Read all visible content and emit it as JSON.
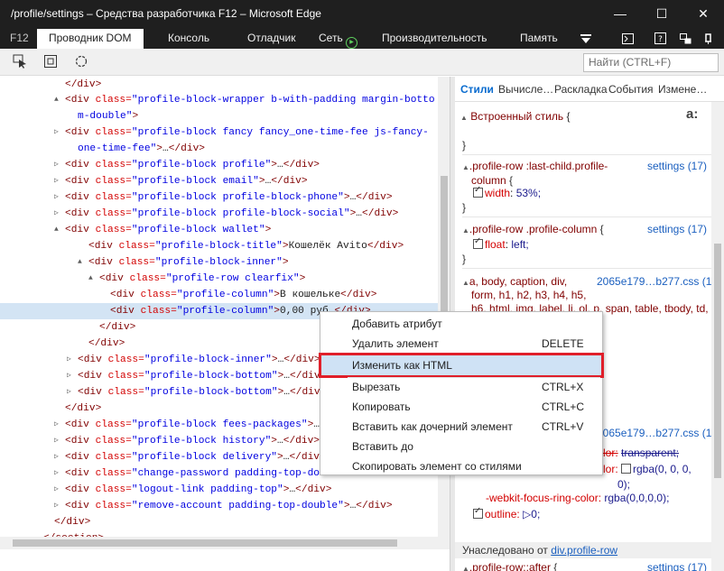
{
  "window": {
    "title": "/profile/settings – Средства разработчика F12 – Microsoft Edge",
    "minimize_icon": "—",
    "maximize_icon": "☐",
    "close_icon": "✕"
  },
  "tabs": {
    "f12": "F12",
    "items": [
      "Проводник DOM",
      "Консоль",
      "Отладчик",
      "Сеть",
      "Производительность",
      "Память"
    ],
    "network_icon": "▶"
  },
  "toolbar": {
    "find_placeholder": "Найти (CTRL+F)"
  },
  "dom_lines": [
    {
      "tri": "",
      "parts": [
        [
          "tag",
          "</div>"
        ]
      ]
    },
    {
      "tri": "▲",
      "parts": [
        [
          "tag",
          "<div "
        ],
        [
          "an",
          "class="
        ],
        [
          "av",
          "\"profile-block-wrapper b-with-padding margin-botto"
        ]
      ]
    },
    {
      "tri": "",
      "parts": [
        [
          "av",
          "m-double\""
        ],
        [
          "tag",
          ">"
        ]
      ]
    },
    {
      "tri": "▷",
      "parts": [
        [
          "tag",
          "<div "
        ],
        [
          "an",
          "class="
        ],
        [
          "av",
          "\"profile-block fancy fancy_one-time-fee js-fancy-"
        ]
      ]
    },
    {
      "tri": "",
      "parts": [
        [
          "av",
          "one-time-fee\""
        ],
        [
          "tag",
          ">"
        ],
        [
          "tx",
          "…"
        ],
        [
          "tag",
          "</div>"
        ]
      ]
    },
    {
      "tri": "▷",
      "parts": [
        [
          "tag",
          "<div "
        ],
        [
          "an",
          "class="
        ],
        [
          "av",
          "\"profile-block profile\""
        ],
        [
          "tag",
          ">"
        ],
        [
          "tx",
          "…"
        ],
        [
          "tag",
          "</div>"
        ]
      ]
    },
    {
      "tri": "▷",
      "parts": [
        [
          "tag",
          "<div "
        ],
        [
          "an",
          "class="
        ],
        [
          "av",
          "\"profile-block email\""
        ],
        [
          "tag",
          ">"
        ],
        [
          "tx",
          "…"
        ],
        [
          "tag",
          "</div>"
        ]
      ]
    },
    {
      "tri": "▷",
      "parts": [
        [
          "tag",
          "<div "
        ],
        [
          "an",
          "class="
        ],
        [
          "av",
          "\"profile-block profile-block-phone\""
        ],
        [
          "tag",
          ">"
        ],
        [
          "tx",
          "…"
        ],
        [
          "tag",
          "</div>"
        ]
      ]
    },
    {
      "tri": "▷",
      "parts": [
        [
          "tag",
          "<div "
        ],
        [
          "an",
          "class="
        ],
        [
          "av",
          "\"profile-block profile-block-social\""
        ],
        [
          "tag",
          ">"
        ],
        [
          "tx",
          "…"
        ],
        [
          "tag",
          "</div>"
        ]
      ]
    },
    {
      "tri": "▲",
      "parts": [
        [
          "tag",
          "<div "
        ],
        [
          "an",
          "class="
        ],
        [
          "av",
          "\"profile-block wallet\""
        ],
        [
          "tag",
          ">"
        ]
      ]
    },
    {
      "tri": "",
      "parts": [
        [
          "tag",
          "<div "
        ],
        [
          "an",
          "class="
        ],
        [
          "av",
          "\"profile-block-title\""
        ],
        [
          "tag",
          ">"
        ],
        [
          "tx",
          "Кошелёк Avito"
        ],
        [
          "tag",
          "</div>"
        ]
      ]
    },
    {
      "tri": "▲",
      "parts": [
        [
          "tag",
          "<div "
        ],
        [
          "an",
          "class="
        ],
        [
          "av",
          "\"profile-block-inner\""
        ],
        [
          "tag",
          ">"
        ]
      ]
    },
    {
      "tri": "▲",
      "parts": [
        [
          "tag",
          "<div "
        ],
        [
          "an",
          "class="
        ],
        [
          "av",
          "\"profile-row clearfix\""
        ],
        [
          "tag",
          ">"
        ]
      ]
    },
    {
      "tri": "",
      "parts": [
        [
          "tag",
          "<div "
        ],
        [
          "an",
          "class="
        ],
        [
          "av",
          "\"profile-column\""
        ],
        [
          "tag",
          ">"
        ],
        [
          "tx",
          "В кошельке"
        ],
        [
          "tag",
          "</div>"
        ]
      ]
    },
    {
      "tri": "",
      "parts": [
        [
          "tag",
          "<div "
        ],
        [
          "an",
          "class="
        ],
        [
          "av",
          "\"profile-column\""
        ],
        [
          "tag",
          ">"
        ],
        [
          "tx",
          "0,00 руб."
        ],
        [
          "tag",
          "</div>"
        ]
      ]
    },
    {
      "tri": "",
      "parts": [
        [
          "tag",
          "</div>"
        ]
      ]
    },
    {
      "tri": "",
      "parts": [
        [
          "tag",
          "</div>"
        ]
      ]
    },
    {
      "tri": "▷",
      "parts": [
        [
          "tag",
          "<div "
        ],
        [
          "an",
          "class="
        ],
        [
          "av",
          "\"profile-block-inner\""
        ],
        [
          "tag",
          ">"
        ],
        [
          "tx",
          "…"
        ],
        [
          "tag",
          "</div>"
        ]
      ]
    },
    {
      "tri": "▷",
      "parts": [
        [
          "tag",
          "<div "
        ],
        [
          "an",
          "class="
        ],
        [
          "av",
          "\"profile-block-bottom\""
        ],
        [
          "tag",
          ">"
        ],
        [
          "tx",
          "…"
        ],
        [
          "tag",
          "</div>"
        ]
      ]
    },
    {
      "tri": "▷",
      "parts": [
        [
          "tag",
          "<div "
        ],
        [
          "an",
          "class="
        ],
        [
          "av",
          "\"profile-block-bottom\""
        ],
        [
          "tag",
          ">"
        ],
        [
          "tx",
          "…"
        ],
        [
          "tag",
          "</div>"
        ]
      ]
    },
    {
      "tri": "",
      "parts": [
        [
          "tag",
          "</div>"
        ]
      ]
    },
    {
      "tri": "▷",
      "parts": [
        [
          "tag",
          "<div "
        ],
        [
          "an",
          "class="
        ],
        [
          "av",
          "\"profile-block fees-packages\""
        ],
        [
          "tag",
          ">"
        ],
        [
          "tx",
          "…"
        ],
        [
          "tag",
          "</div>"
        ]
      ]
    },
    {
      "tri": "▷",
      "parts": [
        [
          "tag",
          "<div "
        ],
        [
          "an",
          "class="
        ],
        [
          "av",
          "\"profile-block history\""
        ],
        [
          "tag",
          ">"
        ],
        [
          "tx",
          "…"
        ],
        [
          "tag",
          "</div>"
        ]
      ]
    },
    {
      "tri": "▷",
      "parts": [
        [
          "tag",
          "<div "
        ],
        [
          "an",
          "class="
        ],
        [
          "av",
          "\"profile-block delivery\""
        ],
        [
          "tag",
          ">"
        ],
        [
          "tx",
          "…"
        ],
        [
          "tag",
          "</div>"
        ]
      ]
    },
    {
      "tri": "▷",
      "parts": [
        [
          "tag",
          "<div "
        ],
        [
          "an",
          "class="
        ],
        [
          "av",
          "\"change-password padding-top-double\""
        ],
        [
          "tag",
          ">"
        ],
        [
          "tx",
          "…"
        ],
        [
          "tag",
          "</div>"
        ]
      ]
    },
    {
      "tri": "▷",
      "parts": [
        [
          "tag",
          "<div "
        ],
        [
          "an",
          "class="
        ],
        [
          "av",
          "\"logout-link padding-top\""
        ],
        [
          "tag",
          ">"
        ],
        [
          "tx",
          "…"
        ],
        [
          "tag",
          "</div>"
        ]
      ]
    },
    {
      "tri": "▷",
      "parts": [
        [
          "tag",
          "<div "
        ],
        [
          "an",
          "class="
        ],
        [
          "av",
          "\"remove-account padding-top-double\""
        ],
        [
          "tag",
          ">"
        ],
        [
          "tx",
          "…"
        ],
        [
          "tag",
          "</div>"
        ]
      ]
    },
    {
      "tri": "",
      "parts": [
        [
          "tag",
          "</div>"
        ]
      ]
    },
    {
      "tri": "",
      "parts": [
        [
          "tag",
          "</section>"
        ]
      ]
    }
  ],
  "styles": {
    "subtabs": [
      "Стили",
      "Вычисле…",
      "Раскладка",
      "События",
      "Измене…"
    ],
    "inline_label": "Встроенный стиль",
    "aa_icon": "a:",
    "rule1": {
      "selector_line1": ".profile-row :last-child.profile-",
      "selector_line2": "column",
      "source": "settings (17)",
      "prop": "width",
      "value": "53%;"
    },
    "rule2": {
      "selector": ".profile-row .profile-column",
      "source": "settings (17)",
      "prop": "float",
      "value": "left;"
    },
    "rule3": {
      "selector_line1": "a, body, caption, div,",
      "selector_line2": "form, h1, h2, h3, h4, h5,",
      "selector_line3": "h6, html, img, label, li, ol, p, span, table, tbody, td,",
      "source": "2065e179…b277.css (1)"
    },
    "rule4": {
      "source": "2065e179…b277.css (1)",
      "p1_tail": "lor:",
      "p1_val": "transparent;",
      "p2_tail": "lor:",
      "p2_val": "rgba(0, 0, 0,",
      "p2_val2": "0);",
      "p3": "-webkit-focus-ring-color:",
      "p3_val": "rgba(0,0,0,0);",
      "p4": "outline:",
      "p4_val": "▷0;"
    },
    "inherited_prefix": "Унаследовано от ",
    "inherited_link": "div.profile-row",
    "rule5": {
      "selector": ".profile-row::after",
      "source": "settings (17)"
    }
  },
  "context_menu": {
    "items": [
      {
        "label": "Добавить атрибут",
        "shortcut": ""
      },
      {
        "label": "Удалить элемент",
        "shortcut": "DELETE"
      },
      {
        "label": "Изменить как HTML",
        "shortcut": ""
      },
      {
        "label": "Вырезать",
        "shortcut": "CTRL+X"
      },
      {
        "label": "Копировать",
        "shortcut": "CTRL+C"
      },
      {
        "label": "Вставить как дочерний элемент",
        "shortcut": "CTRL+V"
      },
      {
        "label": "Вставить до",
        "shortcut": ""
      },
      {
        "label": "Скопировать элемент со стилями",
        "shortcut": ""
      }
    ]
  }
}
